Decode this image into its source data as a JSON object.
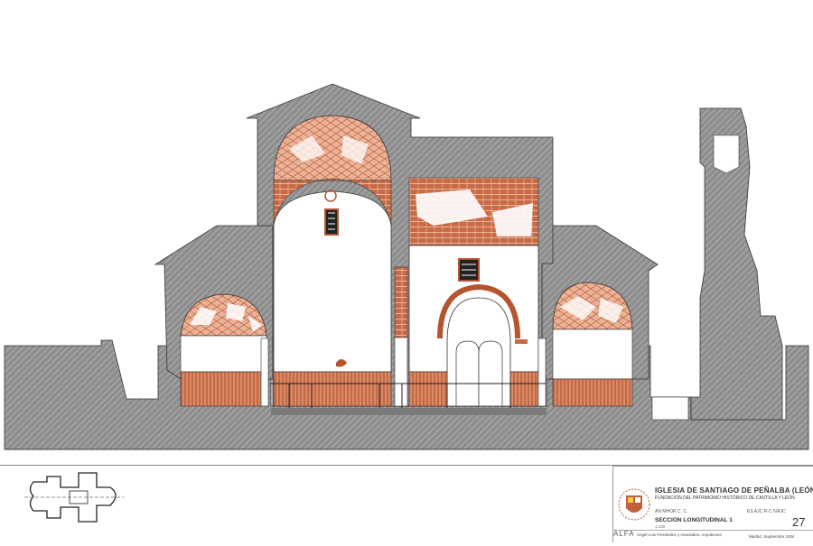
{
  "title_block": {
    "title": "IGLESIA DE SANTIAGO DE PEÑALBA (LEÓN)",
    "subtitle": "FUNDACIÓN DEL PATRIMONIO HISTÓRICO DE CASTILLA Y LEÓN",
    "label_left": "AN    MHOR C. C.",
    "label_right": "ES  AJC  R-C  IVAJC",
    "sheet_title": "SECCION LONGITUDINAL 1",
    "scale": "1:100",
    "sheet_number": "27",
    "logo": "ALFA",
    "firm": "Angel Luis Fernández y Asociados. Arquitectos",
    "place_date": "Madrid, Septiembre 2004"
  },
  "colors": {
    "hatch_fill": "#8c8c8c",
    "hatch_line": "#d8d8d8",
    "stone_red": "#c0613c",
    "stone_light": "#e7a587",
    "wall_white": "#ffffff",
    "line_dark": "#222222"
  },
  "icons": {
    "shield": "coat-of-arms-icon",
    "plan": "floor-plan-key-icon"
  }
}
